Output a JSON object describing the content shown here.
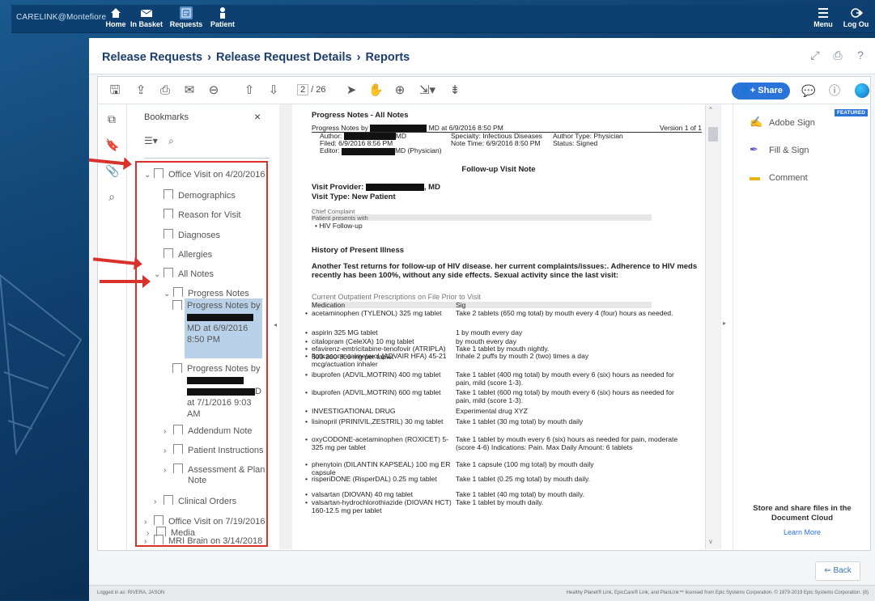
{
  "topnav": {
    "brand": "CARELINK@Montefiore",
    "items": [
      {
        "label": "Home",
        "icon": "home-icon"
      },
      {
        "label": "In Basket",
        "icon": "mail-icon"
      },
      {
        "label": "Requests",
        "icon": "requests-icon",
        "active": true
      },
      {
        "label": "Patient",
        "icon": "patient-icon"
      }
    ],
    "menu_label": "Menu",
    "logout_label": "Log Ou"
  },
  "breadcrumb": {
    "items": [
      "Release Requests",
      "Release Request Details",
      "Reports"
    ]
  },
  "toolbar": {
    "page_current": "2",
    "page_total": "/ 26",
    "share_label": "Share"
  },
  "bookmarks": {
    "title": "Bookmarks",
    "close": "×",
    "items": [
      {
        "label": "Office Visit on 4/20/2016",
        "chevron": "⌄"
      },
      {
        "label": "Demographics"
      },
      {
        "label": "Reason for Visit"
      },
      {
        "label": "Diagnoses"
      },
      {
        "label": "Allergies"
      },
      {
        "label": "All Notes",
        "chevron": "⌄"
      },
      {
        "label": "Progress Notes",
        "chevron": "⌄"
      },
      {
        "label_a": "Progress Notes by",
        "label_b": "MD at 6/9/2016",
        "label_c": "8:50 PM"
      },
      {
        "label_a": "Progress Notes by",
        "label_b": "D",
        "label_c": "at 7/1/2016  9:03",
        "label_d": "AM"
      },
      {
        "label": "Addendum Note",
        "chevron": "›"
      },
      {
        "label": "Patient Instructions",
        "chevron": "›"
      },
      {
        "label_a": "Assessment & Plan",
        "label_b": "Note",
        "chevron": "›"
      },
      {
        "label": "Clinical Orders",
        "chevron": "›"
      },
      {
        "label": "Office Visit on 7/19/2016",
        "chevron": "›"
      },
      {
        "label": "MRI Brain on 3/14/2018",
        "chevron": "›"
      },
      {
        "label": "Media",
        "chevron": "›"
      }
    ]
  },
  "document": {
    "title": "Progress Notes - All Notes",
    "header_prefix": "Progress Notes by",
    "header_suffix": "MD at 6/9/2016  8:50 PM",
    "version": "Version 1 of 1",
    "author_label": "Author:",
    "author_suffix": "MD",
    "filed": "Filed:  6/9/2016  8:56 PM",
    "editor_label": "Editor:",
    "editor_suffix": "MD (Physician)",
    "specialty": "Specialty:  Infectious Diseases",
    "note_time": "Note Time:  6/9/2016  8:50 PM",
    "author_type": "Author Type:  Physician",
    "status": "Status:  Signed",
    "visit_note_title": "Follow-up Visit Note",
    "visit_provider_label": "Visit Provider:",
    "visit_provider_suffix": ", MD",
    "visit_type": "Visit Type: New Patient",
    "chief_complaint": "Chief Complaint",
    "patient_presents": "Patient presents with",
    "complaint_item": "HIV Follow-up",
    "hpi_title": "History of Present Illness",
    "hpi_text": "Another Test returns for follow-up of HIV disease. her current complaints/issues:. Adherence to HIV meds recently has been 100%, without any side effects. Sexual activity since the last visit:",
    "rx_title": "Current Outpatient Prescriptions on File Prior to Visit",
    "col_med": "Medication",
    "col_sig": "Sig",
    "meds": [
      {
        "m": "acetaminophen (TYLENOL) 325 mg tablet",
        "s": "Take 2 tablets (650 mg total) by mouth every 4 (four) hours as needed."
      },
      {
        "m": "aspirin 325 MG tablet",
        "s": "1 by mouth every day"
      },
      {
        "m": "citalopram (CeleXA) 10 mg tablet",
        "s": "by mouth every day"
      },
      {
        "m": "efavirenz-emtricitabine-tenofovir (ATRIPLA) 600-200-300 mg per tablet",
        "s": "Take 1 tablet by mouth nightly."
      },
      {
        "m": "fluticasone-salmeterol (ADVAIR HFA) 45-21 mcg/actuation inhaler",
        "s": "Inhale 2 puffs by mouth 2 (two) times a day"
      },
      {
        "m": "ibuprofen (ADVIL,MOTRIN) 400 mg tablet",
        "s": "Take 1 tablet (400 mg total) by mouth every 6 (six) hours as needed for pain, mild (score 1-3)."
      },
      {
        "m": "ibuprofen (ADVIL,MOTRIN) 600 mg tablet",
        "s": "Take 1 tablet (600 mg total) by mouth every 6 (six) hours as needed for pain, mild (score 1-3)."
      },
      {
        "m": "INVESTIGATIONAL DRUG",
        "s": "Experimental drug XYZ"
      },
      {
        "m": "lisinopril (PRINIVIL,ZESTRIL) 30 mg tablet",
        "s": "Take 1 tablet (30 mg total) by mouth daily"
      },
      {
        "m": "oxyCODONE-acetaminophen (ROXICET) 5-325 mg per tablet",
        "s": "Take 1 tablet by mouth every 6 (six) hours as needed for pain, moderate (score 4-6) Indications: Pain. Max Daily Amount: 6 tablets"
      },
      {
        "m": "phenytoin (DILANTIN KAPSEAL) 100 mg ER capsule",
        "s": "Take 1 capsule (100 mg total) by mouth daily"
      },
      {
        "m": "risperiDONE (RisperDAL) 0.25 mg tablet",
        "s": "Take 1 tablet (0.25 mg total) by mouth daily."
      },
      {
        "m": "valsartan (DIOVAN) 40 mg tablet",
        "s": "Take 1 tablet (40 mg total) by mouth daily."
      },
      {
        "m": "valsartan-hydrochlorothiazide (DIOVAN HCT) 160-12.5 mg per tablet",
        "s": "Take 1 tablet by mouth daily."
      }
    ]
  },
  "right_panel": {
    "featured": "FEATURED",
    "tools": [
      {
        "label": "Adobe Sign",
        "icon": "adobe-sign-icon"
      },
      {
        "label": "Fill & Sign",
        "icon": "fill-sign-icon"
      },
      {
        "label": "Comment",
        "icon": "comment-icon"
      }
    ],
    "store_text": "Store and share files in the Document Cloud",
    "learn_more": "Learn More"
  },
  "back_label": "Back",
  "footer": {
    "left": "Logged in as: RIVERA, JASON",
    "right": "Healthy Planet® Link, EpicCare® Link, and PlanLink™ licensed from Epic Systems Corporation. © 1979-2019 Epic Systems Corporation. (8)"
  },
  "colors": {
    "nav_bg": "#0d3f70",
    "accent": "#2a73d9",
    "highlight": "#b9d2ea",
    "annotation_red": "#d9312b"
  }
}
